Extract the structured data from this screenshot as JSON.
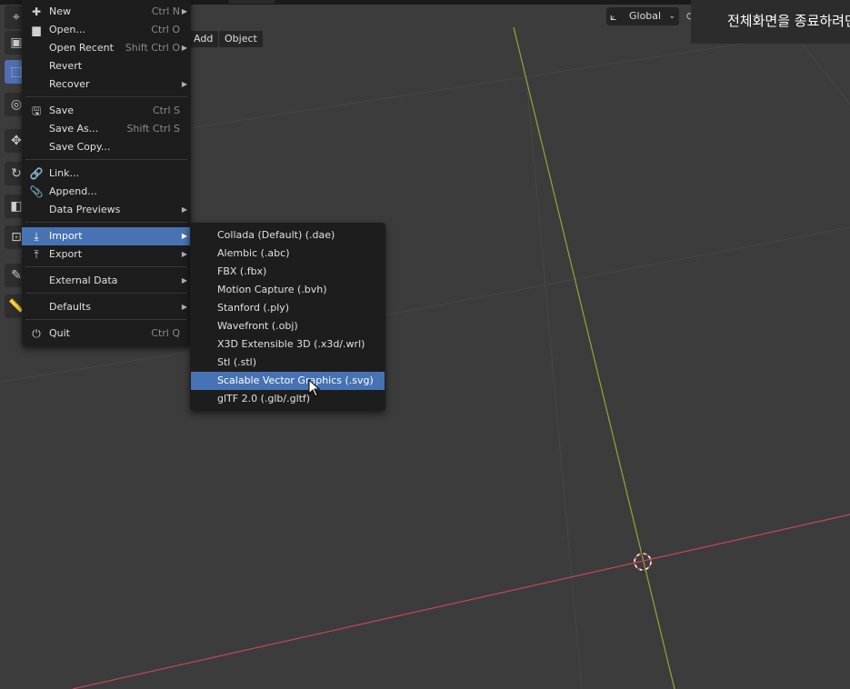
{
  "header": {
    "menus": [
      {
        "label": "Add"
      },
      {
        "label": "Object"
      }
    ],
    "orientation": {
      "label": "Global",
      "icon": "transform-orientation-icon"
    }
  },
  "toast": {
    "text": "전체화면을 종료하려면"
  },
  "file_menu": {
    "items": [
      {
        "label": "New",
        "shortcut": "Ctrl N",
        "icon": "new-file-icon",
        "submenu": true
      },
      {
        "label": "Open...",
        "shortcut": "Ctrl O",
        "icon": "folder-icon"
      },
      {
        "label": "Open Recent",
        "shortcut": "Shift Ctrl O",
        "submenu": true
      },
      {
        "label": "Revert"
      },
      {
        "label": "Recover",
        "submenu": true
      },
      {
        "label": "Save",
        "shortcut": "Ctrl S",
        "icon": "save-icon"
      },
      {
        "label": "Save As...",
        "shortcut": "Shift Ctrl S"
      },
      {
        "label": "Save Copy..."
      },
      {
        "label": "Link...",
        "icon": "link-icon"
      },
      {
        "label": "Append...",
        "icon": "append-icon"
      },
      {
        "label": "Data Previews",
        "submenu": true
      },
      {
        "label": "Import",
        "icon": "import-icon",
        "submenu": true,
        "highlighted": true
      },
      {
        "label": "Export",
        "icon": "export-icon",
        "submenu": true
      },
      {
        "label": "External Data",
        "submenu": true
      },
      {
        "label": "Defaults",
        "submenu": true
      },
      {
        "label": "Quit",
        "shortcut": "Ctrl Q",
        "icon": "power-icon"
      }
    ]
  },
  "import_menu": {
    "items": [
      {
        "label": "Collada (Default) (.dae)"
      },
      {
        "label": "Alembic (.abc)"
      },
      {
        "label": "FBX (.fbx)"
      },
      {
        "label": "Motion Capture (.bvh)"
      },
      {
        "label": "Stanford (.ply)"
      },
      {
        "label": "Wavefront (.obj)"
      },
      {
        "label": "X3D Extensible 3D (.x3d/.wrl)"
      },
      {
        "label": "Stl (.stl)"
      },
      {
        "label": "Scalable Vector Graphics (.svg)",
        "highlighted": true
      },
      {
        "label": "glTF 2.0 (.glb/.gltf)"
      }
    ]
  },
  "colors": {
    "highlight": "#4772b3",
    "x_axis": "#c8455a",
    "y_axis": "#8fa83a",
    "viewport_bg": "#3c3c3c"
  }
}
